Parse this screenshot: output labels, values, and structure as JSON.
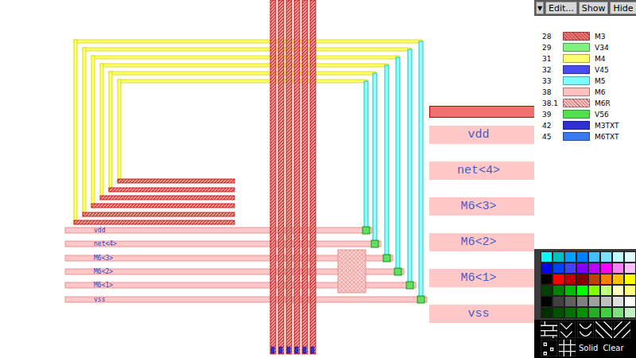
{
  "toolbar": {
    "menu": "▼",
    "buttons": [
      {
        "label": "Edit..."
      },
      {
        "label": "Show"
      },
      {
        "label": "Hide"
      }
    ]
  },
  "layers": [
    {
      "number": "28",
      "name": "M3",
      "color": "#f07070",
      "kind": "hatch"
    },
    {
      "number": "29",
      "name": "V34",
      "color": "#80f080",
      "kind": "solid"
    },
    {
      "number": "31",
      "name": "M4",
      "color": "#ffff70",
      "kind": "solid"
    },
    {
      "number": "32",
      "name": "V45",
      "color": "#4a4af0",
      "kind": "solid"
    },
    {
      "number": "33",
      "name": "M5",
      "color": "#80ffff",
      "kind": "solid"
    },
    {
      "number": "38",
      "name": "M6",
      "color": "#ffc0c0",
      "kind": "solid"
    },
    {
      "number": "38.1",
      "name": "M6R",
      "color": "#ffb8b8",
      "kind": "hatch"
    },
    {
      "number": "39",
      "name": "V56",
      "color": "#50e050",
      "kind": "solid"
    },
    {
      "number": "42",
      "name": "M3TXT",
      "color": "#3030d0",
      "kind": "solid"
    },
    {
      "number": "45",
      "name": "M6TXT",
      "color": "#3a7af0",
      "kind": "solid"
    }
  ],
  "canvas": {
    "net_labels": [
      {
        "label": "vdd"
      },
      {
        "label": "net<4>"
      },
      {
        "label": "M6<3>"
      },
      {
        "label": "M6<2>"
      },
      {
        "label": "M6<1>"
      },
      {
        "label": "vss"
      }
    ]
  },
  "zoom": {
    "net_labels": [
      {
        "label": "vdd"
      },
      {
        "label": "net<4>"
      },
      {
        "label": "M6<3>"
      },
      {
        "label": "M6<2>"
      },
      {
        "label": "M6<1>"
      },
      {
        "label": "vss"
      }
    ]
  },
  "palette": [
    {
      "color": "#00ffff"
    },
    {
      "color": "#00c0c0"
    },
    {
      "color": "#00a0ff"
    },
    {
      "color": "#0080ff"
    },
    {
      "color": "#40c0ff"
    },
    {
      "color": "#80e0ff"
    },
    {
      "color": "#c0ffff"
    },
    {
      "color": "#e0ffff"
    },
    {
      "color": "#0000ff"
    },
    {
      "color": "#0040ff"
    },
    {
      "color": "#4040ff"
    },
    {
      "color": "#8000ff"
    },
    {
      "color": "#c000ff"
    },
    {
      "color": "#ff00ff"
    },
    {
      "color": "#ff80ff"
    },
    {
      "color": "#ffc0ff"
    },
    {
      "color": "#000000"
    },
    {
      "color": "#ff0000"
    },
    {
      "color": "#c00000"
    },
    {
      "color": "#800000"
    },
    {
      "color": "#c04000"
    },
    {
      "color": "#ff8000"
    },
    {
      "color": "#ffc000"
    },
    {
      "color": "#ffff00"
    },
    {
      "color": "#004000"
    },
    {
      "color": "#008000"
    },
    {
      "color": "#00c000"
    },
    {
      "color": "#00ff00"
    },
    {
      "color": "#80ff00"
    },
    {
      "color": "#c0ff80"
    },
    {
      "color": "#ffffc0"
    },
    {
      "color": "#ffff80"
    },
    {
      "color": "#000000"
    },
    {
      "color": "#404040"
    },
    {
      "color": "#606060"
    },
    {
      "color": "#808080"
    },
    {
      "color": "#a0a0a0"
    },
    {
      "color": "#c0c0c0"
    },
    {
      "color": "#e0e0e0"
    },
    {
      "color": "#ffffff"
    },
    {
      "color": "#003000"
    },
    {
      "color": "#005000"
    },
    {
      "color": "#007000"
    },
    {
      "color": "#009000"
    },
    {
      "color": "#20b020"
    },
    {
      "color": "#40d040"
    },
    {
      "color": "#80e080"
    },
    {
      "color": "#c0f0c0"
    }
  ],
  "patterns": {
    "buttons": [
      {
        "label": "Solid"
      },
      {
        "label": "Clear"
      }
    ]
  }
}
